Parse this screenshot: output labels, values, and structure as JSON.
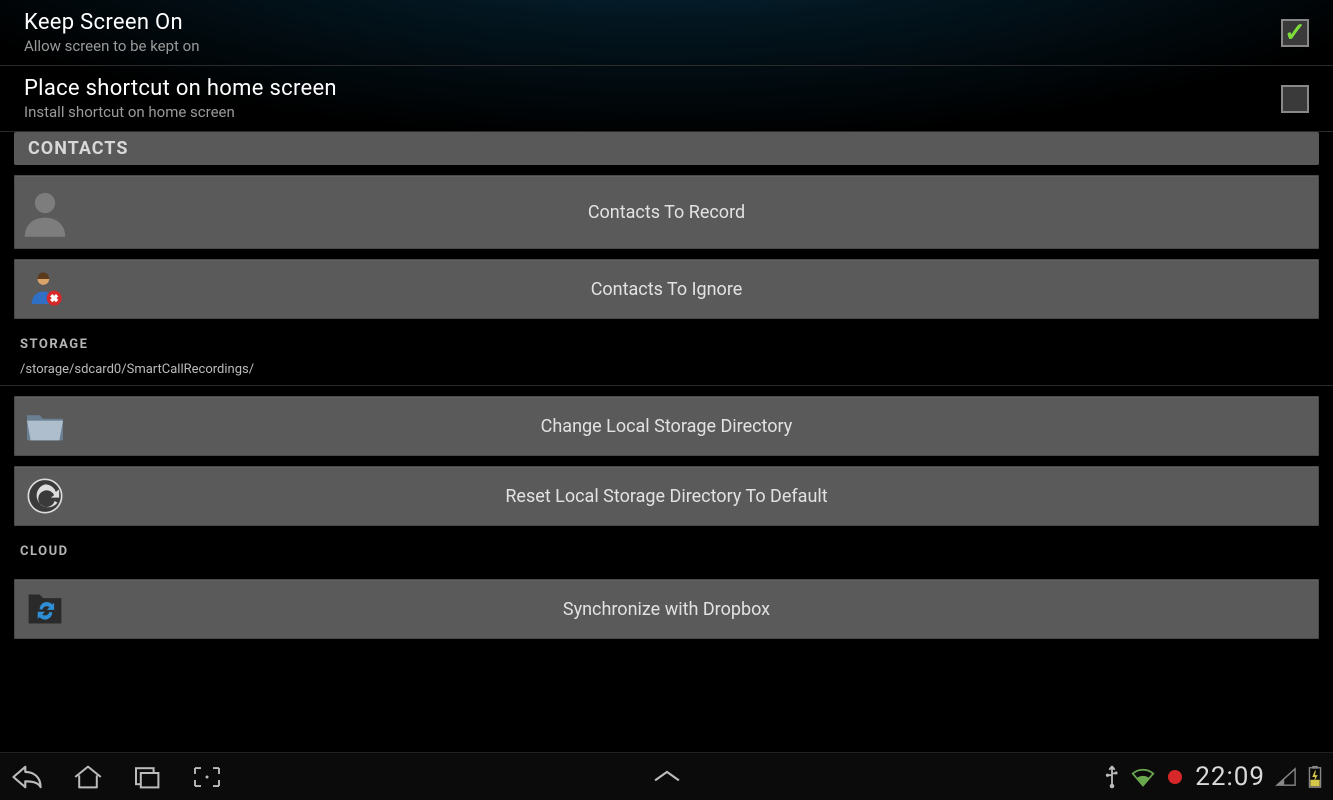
{
  "prefs": {
    "keep_screen": {
      "title": "Keep Screen On",
      "sub": "Allow screen to be kept on",
      "checked": true
    },
    "shortcut": {
      "title": "Place shortcut on home screen",
      "sub": "Install shortcut on home screen",
      "checked": false
    }
  },
  "sections": {
    "contacts_header": "CONTACTS",
    "storage_header": "STORAGE",
    "cloud_header": "CLOUD"
  },
  "buttons": {
    "contacts_record": "Contacts To Record",
    "contacts_ignore": "Contacts To Ignore",
    "change_dir": "Change Local Storage Directory",
    "reset_dir": "Reset Local Storage Directory To Default",
    "sync_dropbox": "Synchronize with Dropbox"
  },
  "storage_path": "/storage/sdcard0/SmartCallRecordings/",
  "statusbar": {
    "time": "22:09"
  }
}
